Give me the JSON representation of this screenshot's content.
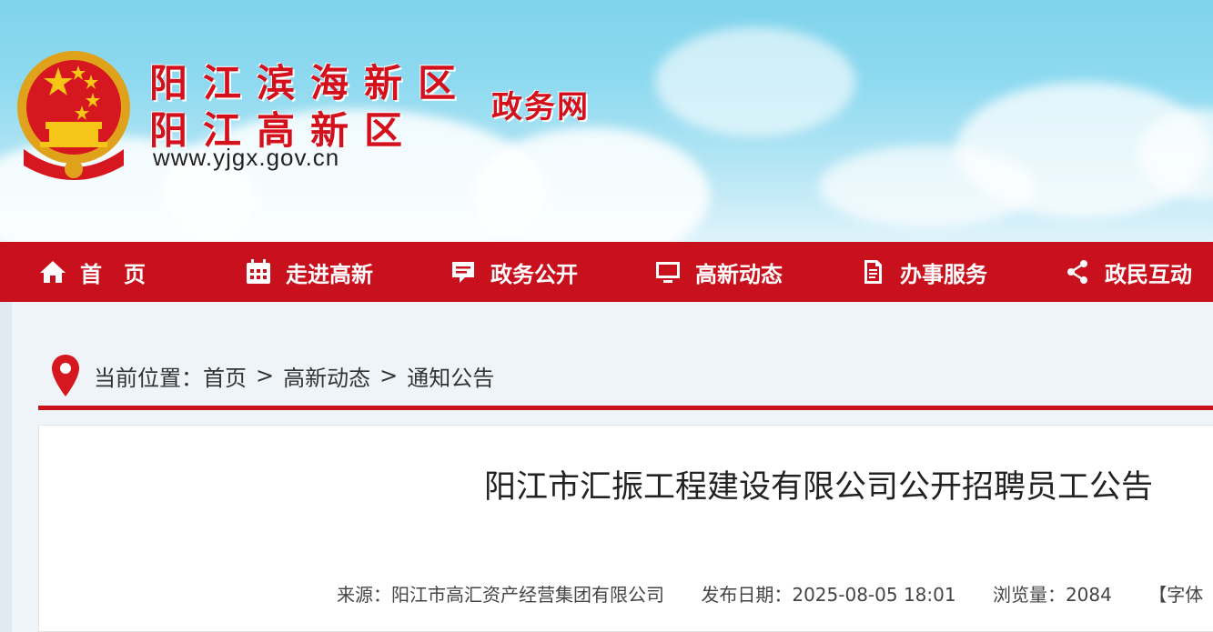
{
  "header": {
    "title_line1": "阳江滨海新区",
    "title_line2": "阳江高新区",
    "subtitle": "政务网",
    "url": "www.yjgx.gov.cn"
  },
  "nav": {
    "items": [
      {
        "label": "首　页",
        "icon": "home-icon"
      },
      {
        "label": "走进高新",
        "icon": "calendar-icon"
      },
      {
        "label": "政务公开",
        "icon": "chat-icon"
      },
      {
        "label": "高新动态",
        "icon": "monitor-icon"
      },
      {
        "label": "办事服务",
        "icon": "document-icon"
      },
      {
        "label": "政民互动",
        "icon": "share-icon"
      }
    ]
  },
  "breadcrumb": {
    "prefix": "当前位置：",
    "items": [
      "首页",
      "高新动态",
      "通知公告"
    ],
    "separator": ">"
  },
  "article": {
    "title": "阳江市汇振工程建设有限公司公开招聘员工公告",
    "source": "来源：阳江市高汇资产经营集团有限公司",
    "date": "发布日期：2025-08-05 18:01",
    "views": "浏览量：2084",
    "font_size": "【字体"
  },
  "colors": {
    "brand_red": "#c8111c",
    "sky": "#8fdaf0"
  }
}
